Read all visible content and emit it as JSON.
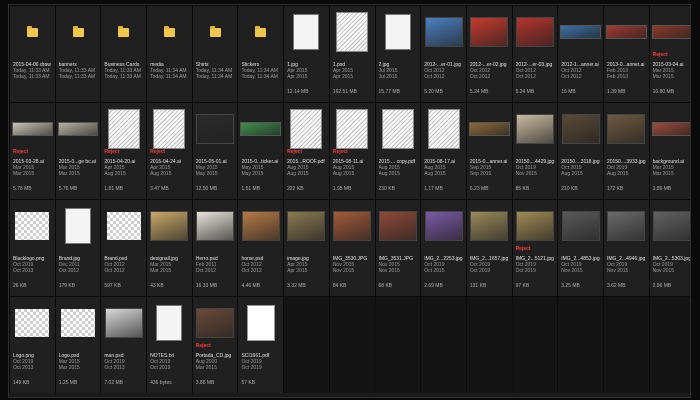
{
  "files": [
    {
      "name": "2015-04-06 draw",
      "d1": "Today, 11:33 AM",
      "d2": "Today, 11:33 AM",
      "size": "",
      "badge": "",
      "thumb": "folder",
      "color": "#f2c74e"
    },
    {
      "name": "banners",
      "d1": "Today, 11:33 AM",
      "d2": "Today, 11:33 AM",
      "size": "",
      "badge": "",
      "thumb": "folder",
      "color": "#f2c74e"
    },
    {
      "name": "Business Cards",
      "d1": "Today, 11:33 AM",
      "d2": "Today, 11:33 AM",
      "size": "",
      "badge": "",
      "thumb": "folder",
      "color": "#f2c74e"
    },
    {
      "name": "media",
      "d1": "Today, 11:34 AM",
      "d2": "Today, 11:34 AM",
      "size": "",
      "badge": "",
      "thumb": "folder",
      "color": "#f2c74e"
    },
    {
      "name": "Shirts",
      "d1": "Today, 11:34 AM",
      "d2": "Today, 11:34 AM",
      "size": "",
      "badge": "",
      "thumb": "folder",
      "color": "#f2c74e"
    },
    {
      "name": "Stickers",
      "d1": "Today, 11:34 AM",
      "d2": "Today, 11:34 AM",
      "size": "",
      "badge": "",
      "thumb": "folder",
      "color": "#f2c74e"
    },
    {
      "name": "1.jpg",
      "d1": "Apr 2015",
      "d2": "Apr 2015",
      "size": "12.14 MB",
      "badge": "",
      "thumb": "doc",
      "color": "#f4f4f4"
    },
    {
      "name": "1.psd",
      "d1": "Apr 2015",
      "d2": "Apr 2015",
      "size": "162.51 MB",
      "badge": "",
      "thumb": "sketch",
      "color": "#dddddd"
    },
    {
      "name": "2.jpg",
      "d1": "Jul 2015",
      "d2": "Jul 2015",
      "size": "15.77 MB",
      "badge": "",
      "thumb": "doc",
      "color": "#f4f4f4"
    },
    {
      "name": "2012-...er-01.jpg",
      "d1": "Oct 2012",
      "d2": "Oct 2012",
      "size": "5.20 MB",
      "badge": "",
      "thumb": "photo",
      "color": "#4c7fbf"
    },
    {
      "name": "2012-...er-02.jpg",
      "d1": "Oct 2012",
      "d2": "Oct 2012",
      "size": "5.24 MB",
      "badge": "",
      "thumb": "photo",
      "color": "#c63b2f"
    },
    {
      "name": "2012-...er-03.jpg",
      "d1": "Oct 2012",
      "d2": "Oct 2012",
      "size": "5.24 MB",
      "badge": "",
      "thumb": "photo",
      "color": "#b5342c"
    },
    {
      "name": "2012-1...anner.ai",
      "d1": "Oct 2012",
      "d2": "Oct 2012",
      "size": "16 MB",
      "badge": "",
      "thumb": "strip",
      "color": "#3d6fa3"
    },
    {
      "name": "2013-0...anner.ai",
      "d1": "Feb 2013",
      "d2": "Feb 2013",
      "size": "1.39 MB",
      "badge": "",
      "thumb": "strip",
      "color": "#a33a33"
    },
    {
      "name": "2015-03-04.ai",
      "d1": "Mar 2015",
      "d2": "Mar 2015",
      "size": "16.80 MB",
      "badge": "Reject",
      "thumb": "strip",
      "color": "#8a3a2a"
    },
    {
      "name": "2015-03-28.ai",
      "d1": "Mar 2015",
      "d2": "Mar 2015",
      "size": "5.76 MB",
      "badge": "Reject",
      "thumb": "strip",
      "color": "#c9c2b3"
    },
    {
      "name": "2015-0...ge bc.ai",
      "d1": "Mar 2015",
      "d2": "Mar 2015",
      "size": "5.76 MB",
      "badge": "",
      "thumb": "strip",
      "color": "#b9b1a2"
    },
    {
      "name": "2015-04-20.ai",
      "d1": "Apr 2015",
      "d2": "Aug 2015",
      "size": "1.81 MB",
      "badge": "Reject",
      "thumb": "sketch",
      "color": "#d8d8d8"
    },
    {
      "name": "2015-04-24.ai",
      "d1": "Apr 2015",
      "d2": "Aug 2015",
      "size": "3.47 MB",
      "badge": "Reject",
      "thumb": "sketch",
      "color": "#9a9a9a"
    },
    {
      "name": "2015-05-01.ai",
      "d1": "May 2015",
      "d2": "May 2015",
      "size": "12.50 MB",
      "badge": "",
      "thumb": "photo",
      "color": "#2b2b2b"
    },
    {
      "name": "2015-0...ticker.ai",
      "d1": "May 2015",
      "d2": "May 2015",
      "size": "1.51 MB",
      "badge": "",
      "thumb": "strip",
      "color": "#3f8f4e"
    },
    {
      "name": "2015...ROOF.pdf",
      "d1": "Aug 2015",
      "d2": "Aug 2015",
      "size": "222 KB",
      "badge": "Reject",
      "thumb": "sketch",
      "color": "#e0e0e0"
    },
    {
      "name": "2015-08-11.ai",
      "d1": "Aug 2015",
      "d2": "Aug 2015",
      "size": "1.95 MB",
      "badge": "Reject",
      "thumb": "sketch",
      "color": "#d0d0d0"
    },
    {
      "name": "2015 ... copy.pdf",
      "d1": "Aug 2015",
      "d2": "Aug 2015",
      "size": "230 KB",
      "badge": "",
      "thumb": "sketch",
      "color": "#e4e4e4"
    },
    {
      "name": "2015-08-17.ai",
      "d1": "Aug 2015",
      "d2": "Aug 2015",
      "size": "1.17 MB",
      "badge": "",
      "thumb": "sketch",
      "color": "#dadada"
    },
    {
      "name": "2015-0...anner.ai",
      "d1": "Sep 2015",
      "d2": "Sep 2015",
      "size": "6.23 MB",
      "badge": "",
      "thumb": "strip",
      "color": "#8a6a3a"
    },
    {
      "name": "20150....4429.jpg",
      "d1": "Oct 2019",
      "d2": "Nov 2015",
      "size": "85 KB",
      "badge": "",
      "thumb": "photo",
      "color": "#c9bba0"
    },
    {
      "name": "20150....3118.jpg",
      "d1": "Oct 2019",
      "d2": "Aug 2015",
      "size": "210 KB",
      "badge": "",
      "thumb": "photo",
      "color": "#5a4a38"
    },
    {
      "name": "20150....3933.jpg",
      "d1": "Oct 2019",
      "d2": "Aug 2015",
      "size": "172 KB",
      "badge": "",
      "thumb": "photo",
      "color": "#6d5a40"
    },
    {
      "name": "background.ai",
      "d1": "Mar 2015",
      "d2": "Mar 2015",
      "size": "3.86 MB",
      "badge": "",
      "thumb": "strip",
      "color": "#9c4a3a"
    },
    {
      "name": "Blacklogo.png",
      "d1": "Oct 2019",
      "d2": "Oct 2013",
      "size": "26 KB",
      "badge": "",
      "thumb": "checker",
      "color": "#ffffff"
    },
    {
      "name": "Brand.jpg",
      "d1": "Dec 2011",
      "d2": "Oct 2012",
      "size": "179 KB",
      "badge": "",
      "thumb": "doc",
      "color": "#f4f4f4"
    },
    {
      "name": "Brand.psd",
      "d1": "Oct 2012",
      "d2": "Oct 2012",
      "size": "597 KB",
      "badge": "",
      "thumb": "checker",
      "color": "#ffffff"
    },
    {
      "name": "designall.jpg",
      "d1": "Mar 2015",
      "d2": "Mar 2015",
      "size": "43 KB",
      "badge": "",
      "thumb": "photo",
      "color": "#c8a868"
    },
    {
      "name": "Herro.psd",
      "d1": "Feb 2011",
      "d2": "Oct 2012",
      "size": "16.33 MB",
      "badge": "",
      "thumb": "photo",
      "color": "#e8e2da"
    },
    {
      "name": "horse.psd",
      "d1": "Oct 2012",
      "d2": "Oct 2012",
      "size": "4.46 MB",
      "badge": "",
      "thumb": "photo",
      "color": "#b57a45"
    },
    {
      "name": "image.jpg",
      "d1": "Apr 2015",
      "d2": "Apr 2015",
      "size": "3.32 MB",
      "badge": "",
      "thumb": "photo",
      "color": "#8a7a52"
    },
    {
      "name": "IMG_3530.JPG",
      "d1": "Nov 2015",
      "d2": "Nov 2015",
      "size": "84 KB",
      "badge": "",
      "thumb": "photo",
      "color": "#a35a3a"
    },
    {
      "name": "IMG_3531.JPG",
      "d1": "Nov 2015",
      "d2": "Nov 2015",
      "size": "68 KB",
      "badge": "",
      "thumb": "photo",
      "color": "#8f4a3a"
    },
    {
      "name": "IMG_2...2253.jpg",
      "d1": "Oct 2019",
      "d2": "Oct 2015",
      "size": "2.69 MB",
      "badge": "",
      "thumb": "photo",
      "color": "#7a5aa5"
    },
    {
      "name": "IMG_2...1657.jpg",
      "d1": "Oct 2019",
      "d2": "Oct 2019",
      "size": "131 KB",
      "badge": "",
      "thumb": "photo",
      "color": "#9a8a5a"
    },
    {
      "name": "IMG_2...5121.jpg",
      "d1": "Oct 2019",
      "d2": "Oct 2019",
      "size": "97 KB",
      "badge": "Reject",
      "thumb": "photo",
      "color": "#a08a55"
    },
    {
      "name": "IMG_2...4853.jpg",
      "d1": "Oct 2019",
      "d2": "Nov 2015",
      "size": "3.25 MB",
      "badge": "",
      "thumb": "photo",
      "color": "#5a5a5a"
    },
    {
      "name": "IMG_2...4946.jpg",
      "d1": "Oct 2019",
      "d2": "Nov 2015",
      "size": "3.62 MB",
      "badge": "",
      "thumb": "photo",
      "color": "#6a6a6a"
    },
    {
      "name": "IMG_2...5303.jpg",
      "d1": "Oct 2019",
      "d2": "Nov 2015",
      "size": "2.96 MB",
      "badge": "",
      "thumb": "photo",
      "color": "#626262"
    },
    {
      "name": "Logo.png",
      "d1": "Oct 2019",
      "d2": "Oct 2013",
      "size": "149 KB",
      "badge": "",
      "thumb": "checker",
      "color": "#f2c85a"
    },
    {
      "name": "Logo.psd",
      "d1": "Mar 2015",
      "d2": "Mar 2015",
      "size": "1.25 MB",
      "badge": "",
      "thumb": "checker",
      "color": "#f3d0b0"
    },
    {
      "name": "man.psd",
      "d1": "Oct 2019",
      "d2": "Oct 2013",
      "size": "7.02 MB",
      "badge": "",
      "thumb": "photo",
      "color": "#d8d8d8"
    },
    {
      "name": "NOTES.txt",
      "d1": "Oct 2019",
      "d2": "Oct 2019",
      "size": "436 bytes",
      "badge": "",
      "thumb": "doc",
      "color": "#f4f4f4"
    },
    {
      "name": "Portada_CD.jpg",
      "d1": "Aug 2010",
      "d2": "Mar 2015",
      "size": "3.88 MB",
      "badge": "Reject",
      "thumb": "photo",
      "color": "#6a4a3a"
    },
    {
      "name": "SCI1661.pdf",
      "d1": "Oct 2019",
      "d2": "Oct 2019",
      "size": "57 KB",
      "badge": "",
      "thumb": "sheet",
      "color": "#ffffff"
    }
  ]
}
